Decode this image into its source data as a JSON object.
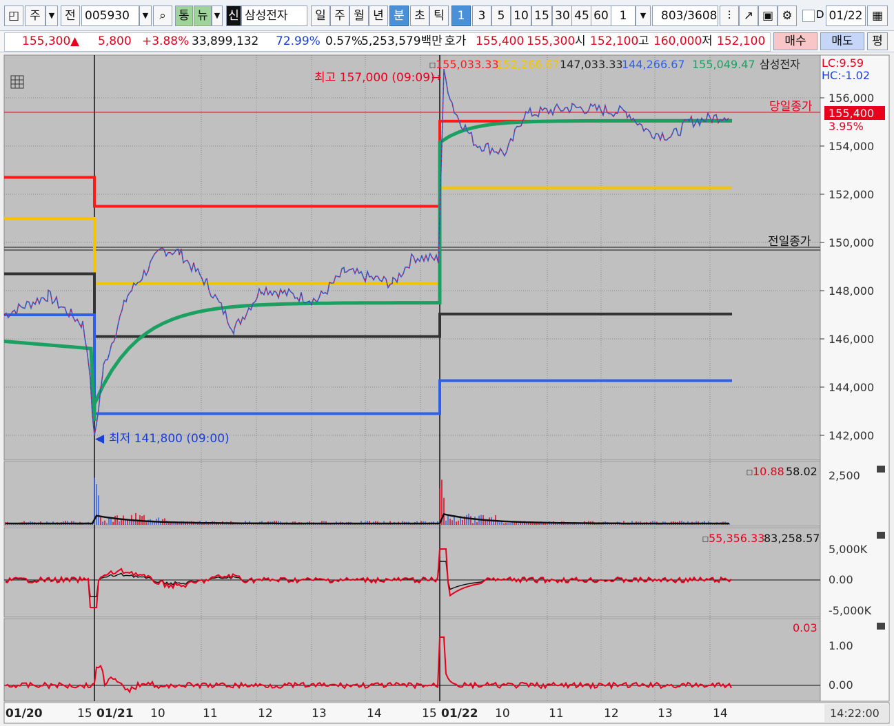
{
  "toolbar": {
    "market": "주",
    "prefix": "전",
    "code": "005930",
    "tag_tong": "통",
    "tag_nyu": "뉴",
    "tag_sin": "신",
    "name": "삼성전자",
    "periods": [
      "일",
      "주",
      "월",
      "년",
      "분",
      "초",
      "틱"
    ],
    "active_period": "분",
    "intervals": [
      "1",
      "3",
      "5",
      "10",
      "15",
      "30",
      "45",
      "60"
    ],
    "active_interval": "1",
    "count": "1",
    "position": "803",
    "total": "/3608",
    "date_check": "D",
    "date": "01/22"
  },
  "quote": {
    "price": "155,300",
    "up_mark": "▲",
    "change": "5,800",
    "change_pct": "+3.88%",
    "volume": "33,899,132",
    "ratio1": "72.99%",
    "ratio2": "0.57%",
    "amount": "5,253,579백만",
    "ask_label": "호가",
    "ask": "155,400",
    "bid": "155,300",
    "open_label": "시",
    "open": "152,100",
    "high_label": "고",
    "high": "160,000",
    "low_label": "저",
    "low": "152,100",
    "buy_btn": "매수",
    "sell_btn": "매도",
    "eval_btn": "평"
  },
  "main_panel": {
    "legend": [
      "155,033.33",
      "152,266.67",
      "147,033.33",
      "144,266.67",
      "155,049.47",
      "삼성전자"
    ],
    "legend_colors": [
      "#ff1a1a",
      "#f5c400",
      "#222222",
      "#2f5fe8",
      "#1aa060",
      "#222222"
    ],
    "lc": "LC:9.59",
    "hc": "HC:-1.02",
    "y_ticks": [
      "156,000",
      "154,000",
      "152,000",
      "150,000",
      "148,000",
      "146,000",
      "144,000",
      "142,000"
    ],
    "close_label": "당일종가",
    "close_value": "155,400",
    "close_pct": "3.95%",
    "prev_close_label": "전일종가",
    "high_note": "최고 157,000 (09:09)",
    "low_note": "최저 141,800 (09:00)"
  },
  "volume_panel": {
    "v1": "10.88",
    "v2": "58.02",
    "tick": "2,500"
  },
  "osc_panel": {
    "v1": "55,356.33",
    "v2": "83,258.57",
    "ticks": [
      "5,000K",
      "0.00",
      "-5,000K"
    ]
  },
  "rate_panel": {
    "v1": "0.03",
    "ticks": [
      "1.00",
      "0.00"
    ]
  },
  "x_axis": {
    "labels": [
      "01/20",
      "15",
      "01/21",
      "10",
      "11",
      "12",
      "13",
      "14",
      "15",
      "01/22",
      "10",
      "11",
      "12",
      "13",
      "14"
    ],
    "time": "14:22:00"
  },
  "colors": {
    "up": "#e8001c",
    "down": "#1a3fd8",
    "accent": "#4a90d9",
    "panel_bg": "#c0c0c0"
  },
  "chart_data": {
    "type": "line",
    "title": "삼성전자",
    "x": [
      "01/20",
      "01/21",
      "01/22"
    ],
    "ylim": [
      141000,
      157500
    ],
    "series": [
      {
        "name": "155,033.33",
        "values": [
          152700,
          151500,
          155033
        ]
      },
      {
        "name": "152,266.67",
        "values": [
          151000,
          148300,
          152267
        ]
      },
      {
        "name": "147,033.33",
        "values": [
          148700,
          146100,
          147033
        ]
      },
      {
        "name": "144,266.67",
        "values": [
          147000,
          142900,
          144267
        ]
      },
      {
        "name": "155,049.47",
        "values": [
          145900,
          147500,
          155049
        ]
      }
    ],
    "price_extremes": {
      "high": 157000,
      "high_time": "09:09",
      "low": 141800,
      "low_time": "09:00"
    },
    "last_close": 155400
  }
}
